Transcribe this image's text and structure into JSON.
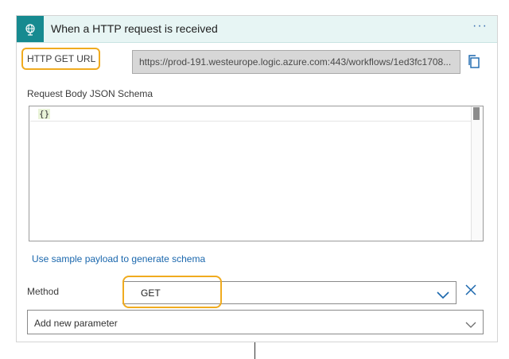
{
  "card": {
    "title": "When a HTTP request is received",
    "menu_label": "···"
  },
  "url_field": {
    "label": "HTTP GET URL",
    "value": "https://prod-191.westeurope.logic.azure.com:443/workflows/1ed3fc1708..."
  },
  "schema": {
    "label": "Request Body JSON Schema",
    "value": "{}"
  },
  "sample_link": "Use sample payload to generate schema",
  "method": {
    "label": "Method",
    "value": "GET"
  },
  "add_parameter": {
    "placeholder": "Add new parameter"
  },
  "icons": {
    "trigger": "globe-request-icon",
    "copy": "copy-icon",
    "dropdown": "chevron-down-icon",
    "clear": "close-icon"
  },
  "colors": {
    "trigger_icon_bg": "#168a90",
    "header_bg": "#e7f5f4",
    "highlight": "#f0ab1f",
    "link": "#1a67ad"
  }
}
